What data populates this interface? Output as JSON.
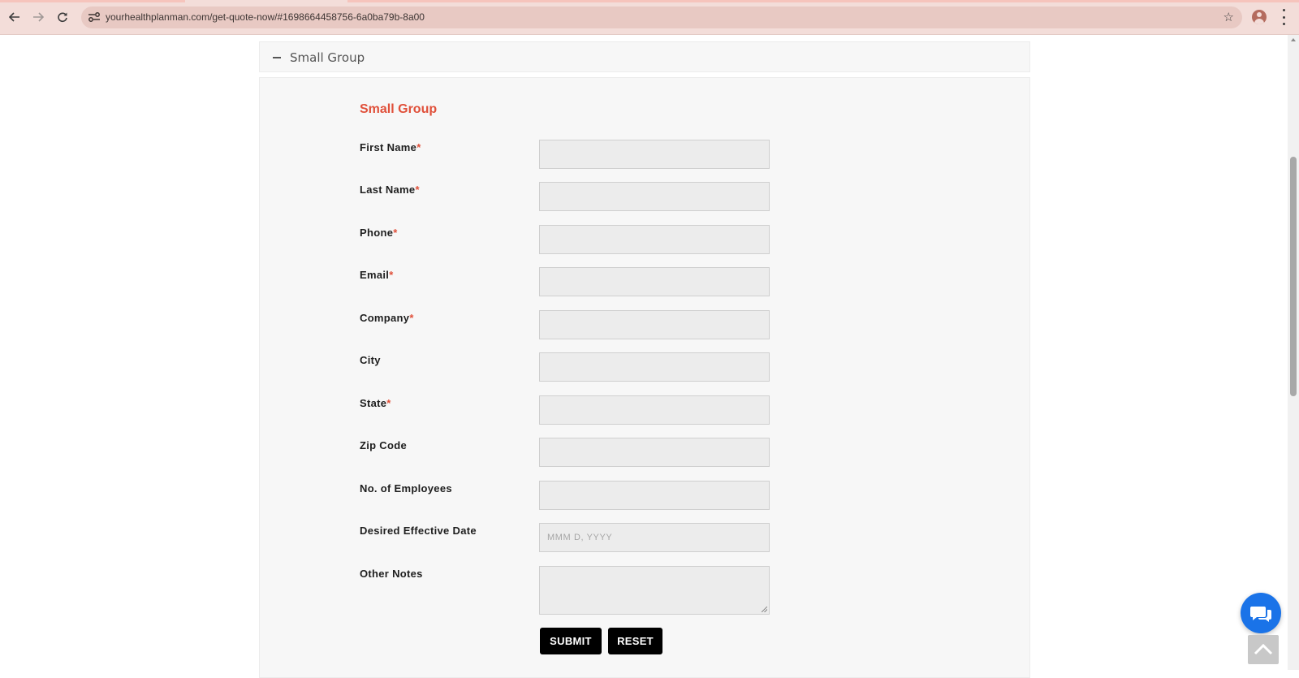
{
  "browser": {
    "url": "yourhealthplanman.com/get-quote-now/#1698664458756-6a0ba79b-8a00",
    "icons": {
      "back": "back-arrow-icon",
      "forward": "forward-arrow-icon",
      "reload": "reload-icon",
      "site": "site-settings-icon",
      "bookmark": "star-icon",
      "profile": "profile-avatar-icon",
      "menu": "more-vert-icon"
    }
  },
  "accordion": {
    "title": "Small Group"
  },
  "form": {
    "title": "Small Group",
    "fields": [
      {
        "label": "First Name",
        "required": "*"
      },
      {
        "label": "Last Name",
        "required": "*"
      },
      {
        "label": "Phone",
        "required": "*"
      },
      {
        "label": "Email",
        "required": "*"
      },
      {
        "label": "Company",
        "required": "*"
      },
      {
        "label": "City",
        "required": ""
      },
      {
        "label": "State",
        "required": "*"
      },
      {
        "label": "Zip Code",
        "required": ""
      },
      {
        "label": "No. of Employees",
        "required": ""
      },
      {
        "label": "Desired Effective Date",
        "required": "",
        "placeholder": "MMM D, YYYY"
      },
      {
        "label": "Other Notes",
        "required": ""
      }
    ],
    "submit_label": "SUBMIT",
    "reset_label": "RESET"
  },
  "colors": {
    "accent": "#e0503a",
    "chat_button": "#1a73e8"
  }
}
